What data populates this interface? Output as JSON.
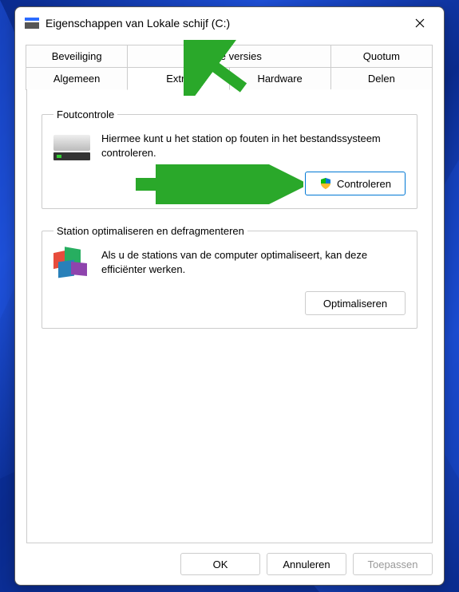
{
  "window": {
    "title": "Eigenschappen van Lokale schijf (C:)"
  },
  "tabs": {
    "row1": [
      "Beveiliging",
      "Vorige versies",
      "",
      "Quotum"
    ],
    "row2": [
      "Algemeen",
      "Extra",
      "Hardware",
      "Delen"
    ],
    "active": "Extra"
  },
  "errorCheck": {
    "legend": "Foutcontrole",
    "text": "Hiermee kunt u het station op fouten in het bestandssysteem controleren.",
    "button": "Controleren"
  },
  "optimize": {
    "legend": "Station optimaliseren en defragmenteren",
    "text": "Als u de stations van de computer optimaliseert, kan deze efficiënter werken.",
    "button": "Optimaliseren"
  },
  "footer": {
    "ok": "OK",
    "cancel": "Annuleren",
    "apply": "Toepassen"
  }
}
